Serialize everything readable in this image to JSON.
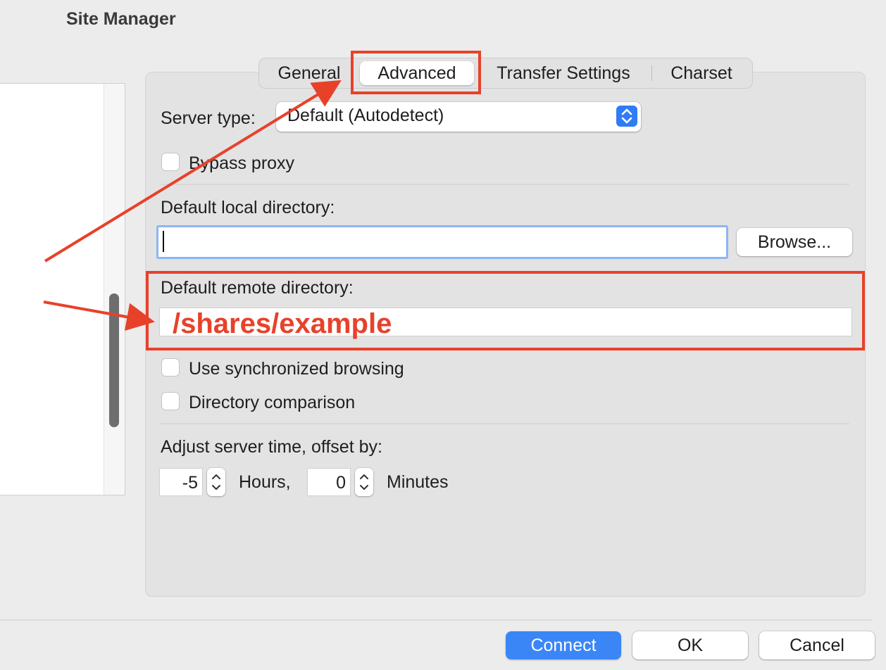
{
  "window": {
    "title": "Site Manager"
  },
  "tabs": [
    {
      "label": "General",
      "active": false
    },
    {
      "label": "Advanced",
      "active": true
    },
    {
      "label": "Transfer Settings",
      "active": false
    },
    {
      "label": "Charset",
      "active": false
    }
  ],
  "advanced": {
    "server_type_label": "Server type:",
    "server_type_value": "Default (Autodetect)",
    "bypass_proxy_label": "Bypass proxy",
    "bypass_proxy_checked": false,
    "local_dir_label": "Default local directory:",
    "local_dir_value": "",
    "browse_label": "Browse...",
    "remote_dir_label": "Default remote directory:",
    "remote_dir_value": "/shares/example",
    "sync_browsing_label": "Use synchronized browsing",
    "sync_browsing_checked": false,
    "dir_comparison_label": "Directory comparison",
    "dir_comparison_checked": false,
    "time_offset_label": "Adjust server time, offset by:",
    "hours_value": "-5",
    "hours_label": "Hours,",
    "minutes_value": "0",
    "minutes_label": "Minutes"
  },
  "footer": {
    "connect_label": "Connect",
    "ok_label": "OK",
    "cancel_label": "Cancel"
  },
  "colors": {
    "accent": "#3b86f7",
    "annotation": "#e8412a"
  },
  "icons": {
    "select_stepper": "chevron-up-down-icon",
    "arrows": "annotation-arrow"
  }
}
